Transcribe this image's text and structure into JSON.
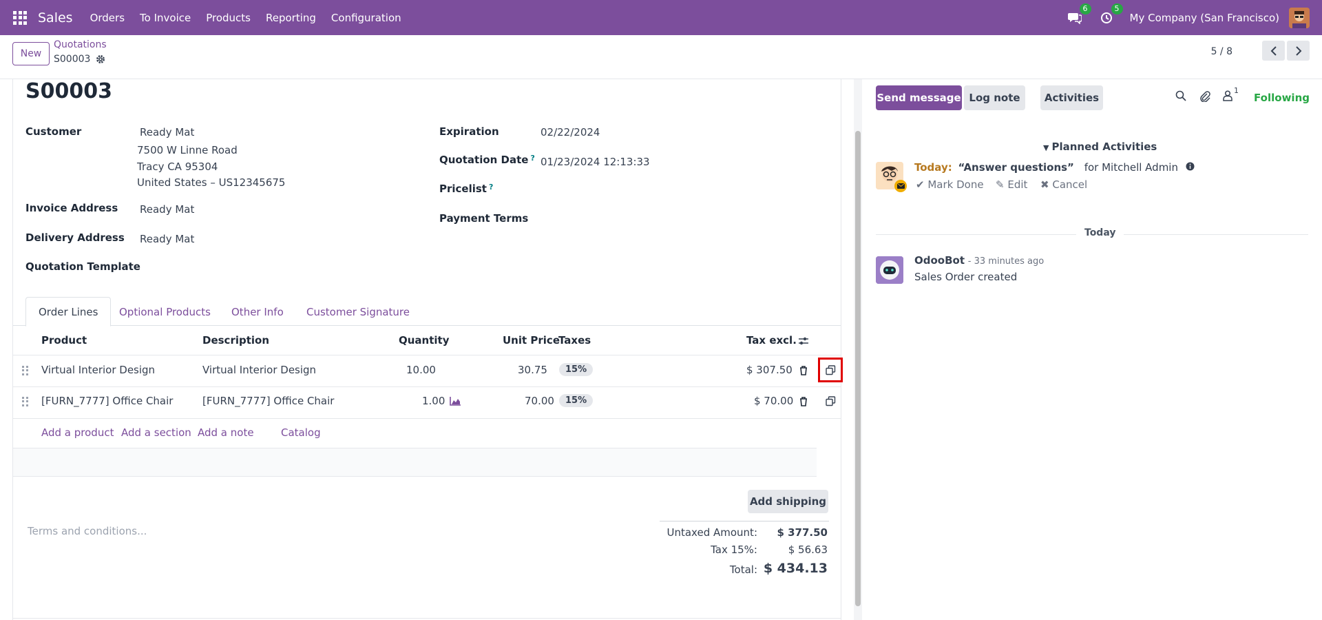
{
  "navbar": {
    "app_name": "Sales",
    "menu": [
      "Orders",
      "To Invoice",
      "Products",
      "Reporting",
      "Configuration"
    ],
    "messages_count": "6",
    "activities_count": "5",
    "company": "My Company (San Francisco)"
  },
  "control_panel": {
    "new_label": "New",
    "breadcrumb_parent": "Quotations",
    "breadcrumb_current": "S00003",
    "pager": "5 / 8"
  },
  "form": {
    "name": "S00003",
    "customer_label": "Customer",
    "customer_name": "Ready Mat",
    "customer_address": [
      "7500 W Linne Road",
      "Tracy CA 95304",
      "United States – US12345675"
    ],
    "invoice_address_label": "Invoice Address",
    "invoice_address": "Ready Mat",
    "delivery_address_label": "Delivery Address",
    "delivery_address": "Ready Mat",
    "quotation_template_label": "Quotation Template",
    "expiration_label": "Expiration",
    "expiration": "02/22/2024",
    "quotation_date_label": "Quotation Date",
    "quotation_date": "01/23/2024 12:13:33",
    "pricelist_label": "Pricelist",
    "payment_terms_label": "Payment Terms",
    "help_mark": "?"
  },
  "tabs": [
    "Order Lines",
    "Optional Products",
    "Other Info",
    "Customer Signature"
  ],
  "order_lines": {
    "columns": [
      "Product",
      "Description",
      "Quantity",
      "Unit Price",
      "Taxes",
      "Tax excl."
    ],
    "rows": [
      {
        "product": "Virtual Interior Design",
        "description": "Virtual Interior Design",
        "quantity": "10.00",
        "unit_price": "30.75",
        "taxes": "15%",
        "subtotal": "$ 307.50"
      },
      {
        "product": "[FURN_7777] Office Chair",
        "description": "[FURN_7777] Office Chair",
        "quantity": "1.00",
        "unit_price": "70.00",
        "taxes": "15%",
        "subtotal": "$ 70.00"
      }
    ],
    "add_links": [
      "Add a product",
      "Add a section",
      "Add a note",
      "Catalog"
    ]
  },
  "footer": {
    "add_shipping": "Add shipping",
    "terms_placeholder": "Terms and conditions...",
    "untaxed_label": "Untaxed Amount:",
    "untaxed_value": "$ 377.50",
    "tax_label": "Tax 15%:",
    "tax_value": "$ 56.63",
    "total_label": "Total:",
    "total_value": "$ 434.13"
  },
  "chatter": {
    "send_message": "Send message",
    "log_note": "Log note",
    "activities": "Activities",
    "followers_count": "1",
    "following": "Following",
    "planned_title": "Planned Activities",
    "activity_when": "Today:",
    "activity_summary": "“Answer questions”",
    "activity_for": "for Mitchell Admin",
    "mark_done": "Mark Done",
    "edit": "Edit",
    "cancel": "Cancel",
    "today_separator": "Today",
    "message_author": "OdooBot",
    "message_time": "- 33 minutes ago",
    "message_body": "Sales Order created"
  },
  "colors": {
    "brand": "#7c4e9c",
    "following": "#28a745",
    "highlight": "#e00000"
  }
}
